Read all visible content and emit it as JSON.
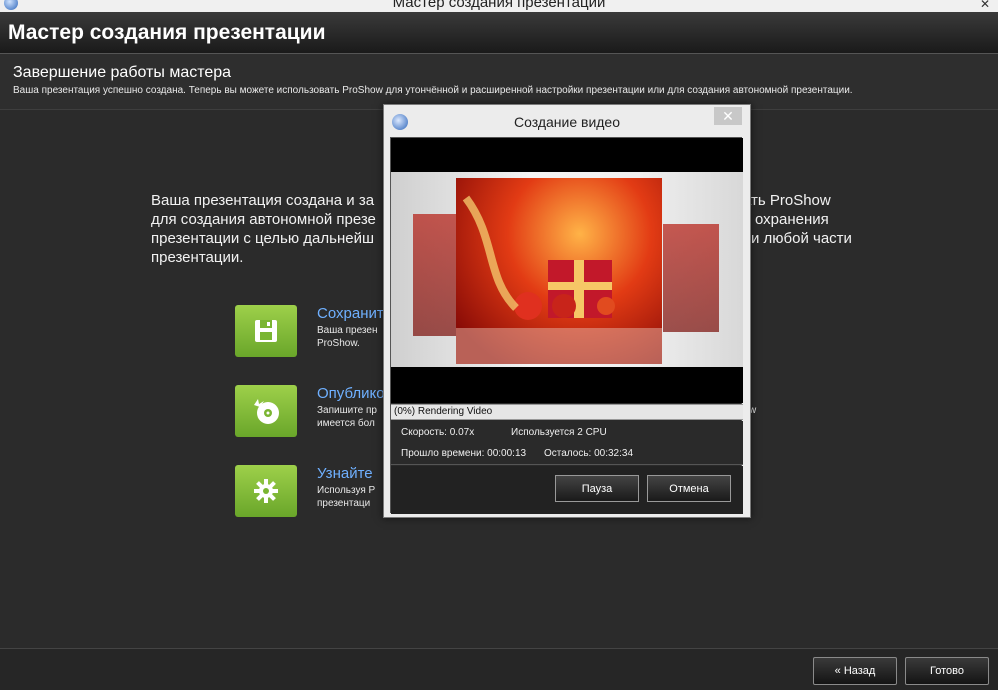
{
  "window": {
    "os_title": "Мастер создания презентации",
    "close_glyph": "✕"
  },
  "header": {
    "title": "Мастер создания презентации"
  },
  "step": {
    "title": "Завершение работы мастера",
    "description": "Ваша презентация успешно создана. Теперь вы можете использовать ProShow для утончённой и расширенной настройки презентации или для создания автономной презентации."
  },
  "main": {
    "intro_visible": "Ваша презентация создана и за... ать ProShow для создания автономной презе... охранения презентации с целью дальнейше... и любой части презентации.",
    "intro_lines": [
      "Ваша презентация создана и за",
      "ать ProShow",
      "для создания автономной презе",
      "охранения",
      "презентации с целью дальнейш",
      "и любой части",
      "презентации."
    ],
    "options": [
      {
        "icon": "floppy-disk-icon",
        "title": "Сохранит",
        "desc_lines": [
          "Ваша презен",
          "ProShow."
        ]
      },
      {
        "icon": "disc-burn-icon",
        "title": "Опублико",
        "desc_lines": [
          "Запишите пр",
          "имеется бол"
        ],
        "desc_right": [
          "w",
          "."
        ]
      },
      {
        "icon": "gear-icon",
        "title": "Узнайте",
        "desc_lines": [
          "Используя P",
          "презентаци"
        ]
      }
    ],
    "colors": {
      "accent_green": "#8cc43c",
      "link_blue": "#6fb0ff"
    }
  },
  "footer": {
    "back_label": "« Назад",
    "done_label": "Готово"
  },
  "dialog": {
    "title": "Создание видео",
    "close_glyph": "✕",
    "status": "(0%) Rendering Video",
    "speed": "Скорость: 0.07x",
    "cpu": "Используется 2 CPU",
    "elapsed": "Прошло времени: 00:00:13",
    "remaining": "Осталось: 00:32:34",
    "progress": 0,
    "pause_label": "Пауза",
    "cancel_label": "Отмена"
  }
}
